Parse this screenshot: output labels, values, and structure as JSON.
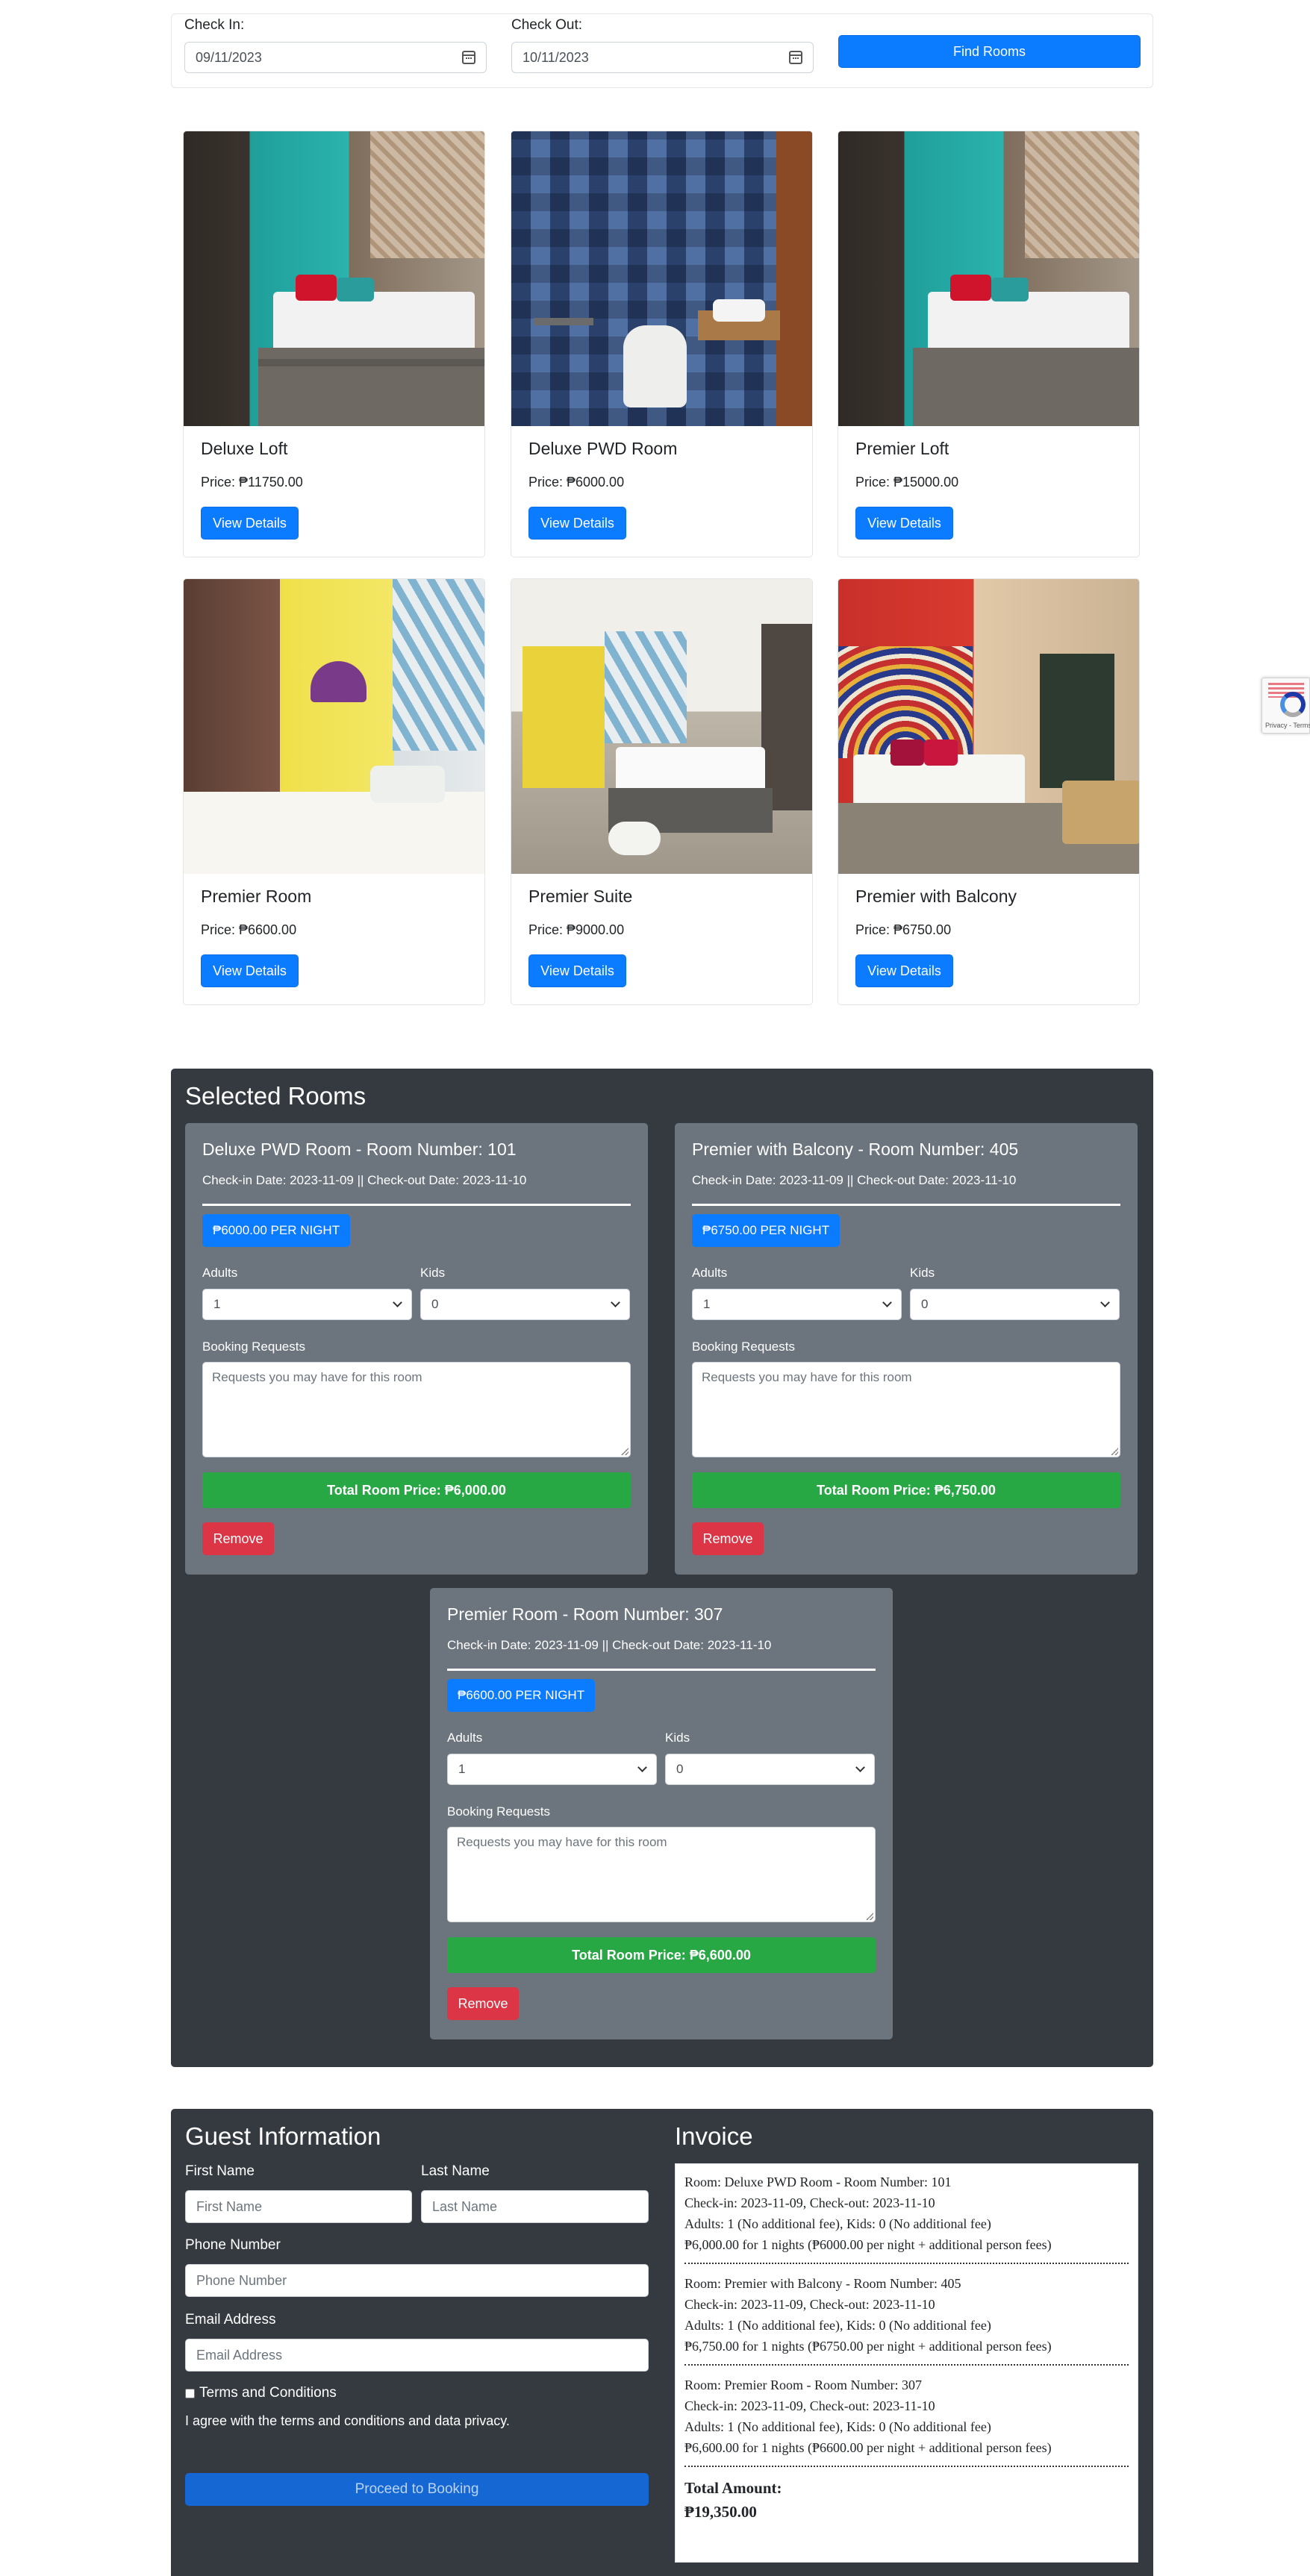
{
  "search": {
    "check_in_label": "Check In:",
    "check_in_value": "09/11/2023",
    "check_out_label": "Check Out:",
    "check_out_value": "10/11/2023",
    "find_button": "Find Rooms"
  },
  "rooms": [
    {
      "name": "Deluxe Loft",
      "price": "Price: ₱11750.00",
      "button": "View Details"
    },
    {
      "name": "Deluxe PWD Room",
      "price": "Price: ₱6000.00",
      "button": "View Details"
    },
    {
      "name": "Premier Loft",
      "price": "Price: ₱15000.00",
      "button": "View Details"
    },
    {
      "name": "Premier Room",
      "price": "Price: ₱6600.00",
      "button": "View Details"
    },
    {
      "name": "Premier Suite",
      "price": "Price: ₱9000.00",
      "button": "View Details"
    },
    {
      "name": "Premier with Balcony",
      "price": "Price: ₱6750.00",
      "button": "View Details"
    }
  ],
  "selected": {
    "title": "Selected Rooms",
    "adults_label": "Adults",
    "kids_label": "Kids",
    "requests_label": "Booking Requests",
    "requests_placeholder": "Requests you may have for this room",
    "remove_label": "Remove",
    "items": [
      {
        "title": "Deluxe PWD Room - Room Number: 101",
        "dates": "Check-in Date: 2023-11-09 || Check-out Date: 2023-11-10",
        "rate": "₱6000.00 PER NIGHT",
        "adults": "1",
        "kids": "0",
        "total": "Total Room Price: ₱6,000.00"
      },
      {
        "title": "Premier with Balcony - Room Number: 405",
        "dates": "Check-in Date: 2023-11-09 || Check-out Date: 2023-11-10",
        "rate": "₱6750.00 PER NIGHT",
        "adults": "1",
        "kids": "0",
        "total": "Total Room Price: ₱6,750.00"
      },
      {
        "title": "Premier Room - Room Number: 307",
        "dates": "Check-in Date: 2023-11-09 || Check-out Date: 2023-11-10",
        "rate": "₱6600.00 PER NIGHT",
        "adults": "1",
        "kids": "0",
        "total": "Total Room Price: ₱6,600.00"
      }
    ]
  },
  "guest": {
    "title": "Guest Information",
    "first_name_label": "First Name",
    "first_name_placeholder": "First Name",
    "last_name_label": "Last Name",
    "last_name_placeholder": "Last Name",
    "phone_label": "Phone Number",
    "phone_placeholder": "Phone Number",
    "email_label": "Email Address",
    "email_placeholder": "Email Address",
    "terms_label": "Terms and Conditions",
    "terms_text": "I agree with the terms and conditions and data privacy.",
    "proceed_button": "Proceed to Booking"
  },
  "invoice": {
    "title": "Invoice",
    "entries": [
      {
        "room": "Room: Deluxe PWD Room - Room Number: 101",
        "dates": "Check-in: 2023-11-09, Check-out: 2023-11-10",
        "guests": "Adults: 1 (No additional fee), Kids: 0 (No additional fee)",
        "amount": "₱6,000.00 for 1 nights (₱6000.00 per night + additional person fees)"
      },
      {
        "room": "Room: Premier with Balcony - Room Number: 405",
        "dates": "Check-in: 2023-11-09, Check-out: 2023-11-10",
        "guests": "Adults: 1 (No additional fee), Kids: 0 (No additional fee)",
        "amount": "₱6,750.00 for 1 nights (₱6750.00 per night + additional person fees)"
      },
      {
        "room": "Room: Premier Room - Room Number: 307",
        "dates": "Check-in: 2023-11-09, Check-out: 2023-11-10",
        "guests": "Adults: 1 (No additional fee), Kids: 0 (No additional fee)",
        "amount": "₱6,600.00 for 1 nights (₱6600.00 per night + additional person fees)"
      }
    ],
    "total_label": "Total Amount:",
    "total_value": "₱19,350.00"
  },
  "recaptcha": {
    "text": "Privacy - Terms"
  },
  "colors": {
    "primary": "#0b7bff",
    "success": "#28a745",
    "danger": "#dc3545",
    "dark": "#343a40",
    "panel": "#6c757d"
  }
}
